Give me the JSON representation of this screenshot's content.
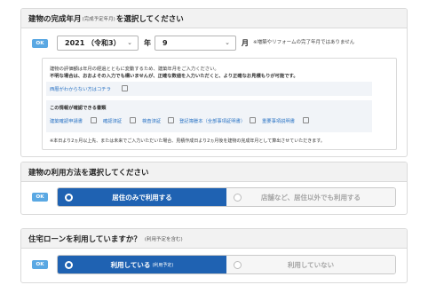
{
  "completion": {
    "title": "建物の完成年月",
    "title_sub": "(完成予定年月)",
    "title_suffix": "を選択してください",
    "ok_badge": "OK",
    "year_value": "2021 （令和3）",
    "year_unit": "年",
    "month_value": "9",
    "month_unit": "月",
    "note": "※増築やリフォームの完了年月ではありません",
    "info": {
      "line1": "建物の評価額は年月の経過とともに変動するため、建築年月をご入力ください。",
      "line2": "不明な場合は、おおよその入力でも構いませんが、正確な数値を入力いただくと、より正確なお見積もりが可能です。",
      "link_unknown": "西暦がわからない方はコチラ",
      "docs_heading": "この情報が確認できる書類",
      "docs": [
        "建築確認申請書",
        "確認済証",
        "検査済証",
        "登記簿謄本（全部事項証明書）",
        "重要事項説明書"
      ],
      "footnote": "※本日より2ヵ月以上先、または未来でご入力いただいた場合、見積作成日より2ヵ月後を建物の完成年月として算出させていただきます。"
    }
  },
  "usage": {
    "title": "建物の利用方法を選択してください",
    "ok_badge": "OK",
    "option_selected": "居住のみで利用する",
    "option_other": "店舗など、居住以外でも利用する"
  },
  "loan": {
    "title": "住宅ローンを利用していますか？",
    "title_sub": "(利用予定を含む)",
    "ok_badge": "OK",
    "option_selected": "利用している",
    "option_selected_sub": "(利用予定)",
    "option_other": "利用していない"
  },
  "colors": {
    "accent": "#1f62b2",
    "ok_badge": "#5aa8e3",
    "link": "#2a73c4"
  },
  "icons": [
    "chevron-down-icon",
    "document-icon",
    "radio-checked-icon",
    "radio-unchecked-icon"
  ]
}
